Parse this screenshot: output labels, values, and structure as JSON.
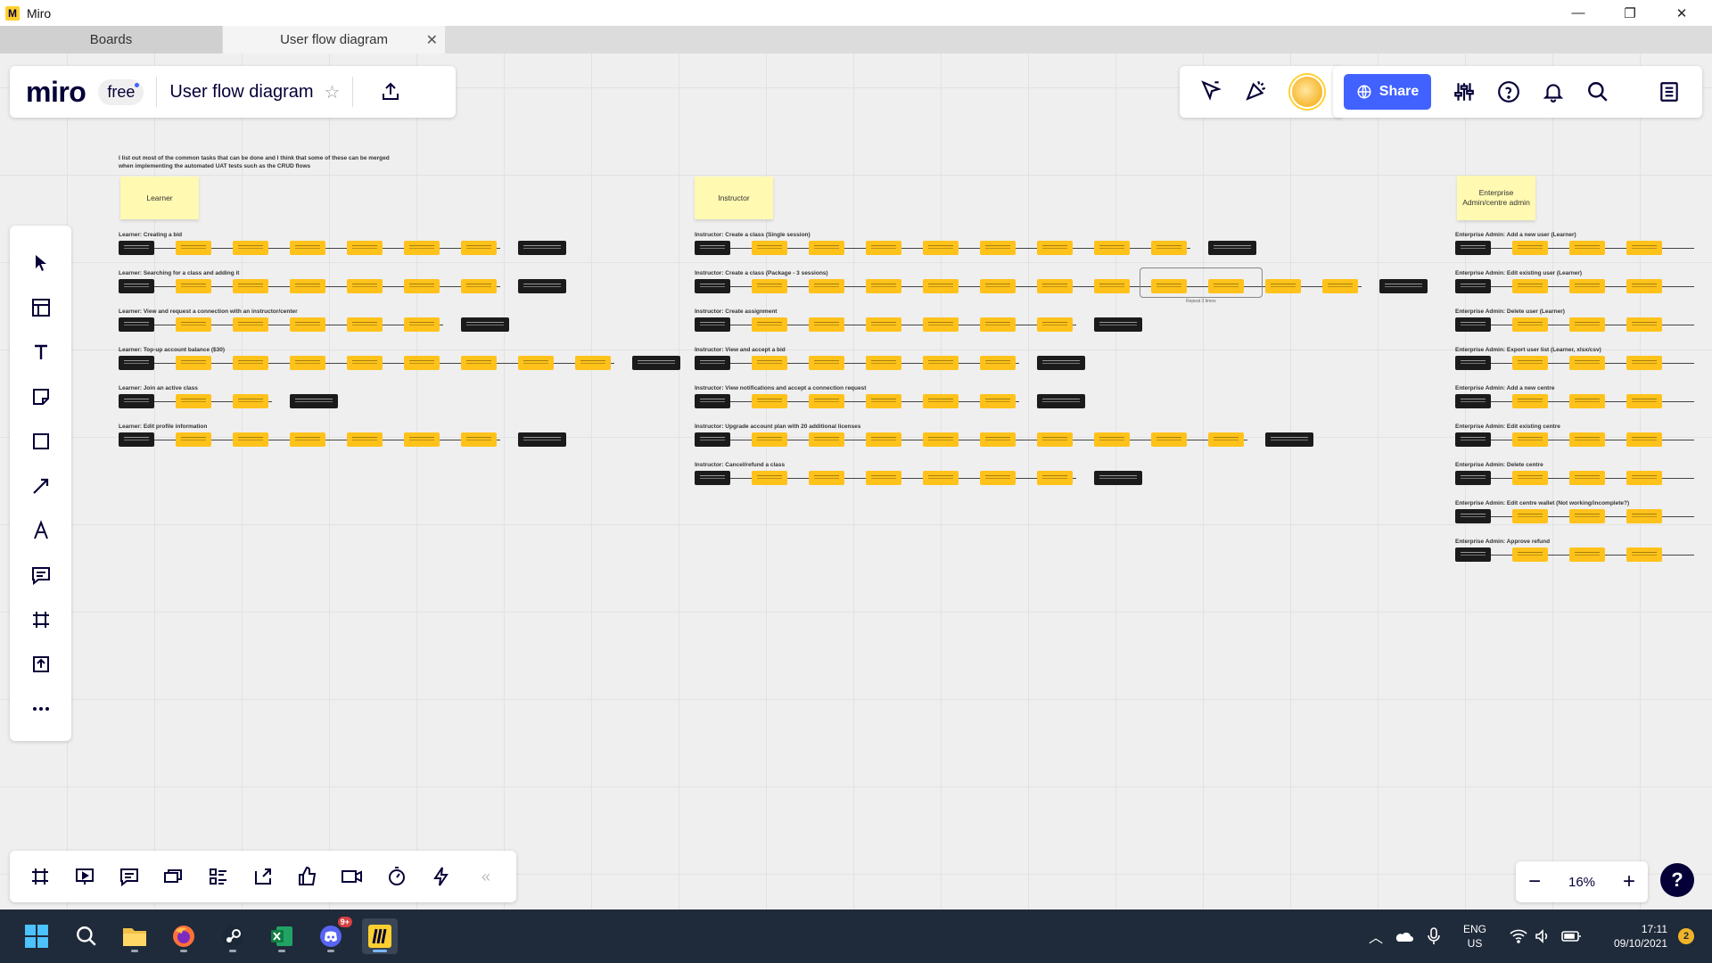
{
  "window": {
    "title": "Miro",
    "minimize": "—",
    "restore": "❐",
    "close": "✕"
  },
  "tabs": [
    {
      "label": "Boards"
    },
    {
      "label": "User flow diagram",
      "close": "✕"
    }
  ],
  "toolbar": {
    "brand": "miro",
    "plan": "free",
    "board_name": "User flow diagram",
    "share_label": "Share",
    "accent": "#4262ff"
  },
  "board": {
    "intro": "I list out most of the common tasks that can be done and I think that some of these can be merged when implementing the automated UAT tests such as the CRUD flows",
    "stickies": [
      {
        "label": "Learner"
      },
      {
        "label": "Instructor"
      },
      {
        "label": "Enterprise Admin/centre admin"
      }
    ],
    "learner_flows": [
      "Learner: Creating a bid",
      "Learner: Searching for a class and adding it",
      "Learner: View and request a connection with an instructor/center",
      "Learner: Top-up account balance ($30)",
      "Learner: Join an active class",
      "Learner: Edit profile information"
    ],
    "instructor_flows": [
      "Instructor: Create a class (Single session)",
      "Instructor: Create a class (Package - 3 sessions)",
      "Instructor: Create assignment",
      "Instructor: View and accept a bid",
      "Instructor: View notifications and accept a connection request",
      "Instructor: Upgrade account plan with 20 additional licenses",
      "Instructor: Cancel/refund a class"
    ],
    "admin_flows": [
      "Enterprise Admin: Add a new user (Learner)",
      "Enterprise Admin: Edit existing user (Learner)",
      "Enterprise Admin: Delete user (Learner)",
      "Enterprise Admin: Export user list (Learner, xlsx/csv)",
      "Enterprise Admin: Add a new centre",
      "Enterprise Admin: Edit existing centre",
      "Enterprise Admin: Delete centre",
      "Enterprise Admin: Edit centre wallet (Not working/incomplete?)",
      "Enterprise Admin: Approve refund"
    ],
    "repeat_note": "Repeat 3 times"
  },
  "zoom": {
    "level": "16%",
    "minus": "−",
    "plus": "+"
  },
  "help": "?",
  "collapse_icon": "«",
  "taskbar": {
    "badge_discord": "9+",
    "lang_line1": "ENG",
    "lang_line2": "US",
    "time": "17:11",
    "date": "09/10/2021",
    "notifications": "2"
  }
}
